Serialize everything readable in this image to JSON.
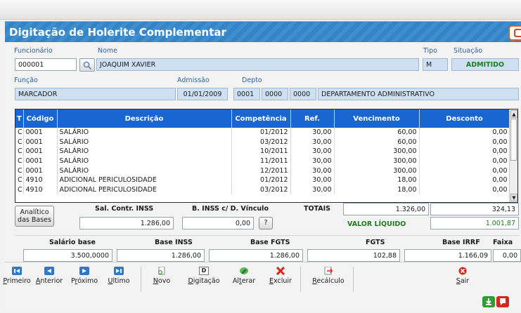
{
  "window": {
    "title": "Digitação de Holerite Complementar"
  },
  "employee": {
    "funcionario_label": "Funcionário",
    "funcionario": "000001",
    "nome_label": "Nome",
    "nome": "JOAQUIM XAVIER",
    "tipo_label": "Tipo",
    "tipo": "M",
    "situacao_label": "Situação",
    "situacao": "ADMITIDO",
    "funcao_label": "Função",
    "funcao": "MARCADOR",
    "admissao_label": "Admissão",
    "admissao": "01/01/2009",
    "depto_label": "Depto",
    "depto1": "0001",
    "depto2": "0000",
    "depto3": "0000",
    "depto_nome": "DEPARTAMENTO ADMINISTRATIVO"
  },
  "grid": {
    "headers": [
      "T",
      "Código",
      "Descrição",
      "Competência",
      "Ref.",
      "Vencimento",
      "Desconto"
    ],
    "rows": [
      [
        "C",
        "0001",
        "SALÁRIO",
        "01/2012",
        "30,00",
        "60,00",
        "0,00"
      ],
      [
        "C",
        "0001",
        "SALÁRIO",
        "03/2012",
        "30,00",
        "60,00",
        "0,00"
      ],
      [
        "C",
        "0001",
        "SALÁRIO",
        "10/2011",
        "30,00",
        "300,00",
        "0,00"
      ],
      [
        "C",
        "0001",
        "SALÁRIO",
        "11/2011",
        "30,00",
        "300,00",
        "0,00"
      ],
      [
        "C",
        "0001",
        "SALÁRIO",
        "12/2011",
        "30,00",
        "300,00",
        "0,00"
      ],
      [
        "C",
        "4910",
        "ADICIONAL PERICULOSIDADE",
        "01/2012",
        "30,00",
        "18,00",
        "0,00"
      ],
      [
        "C",
        "4910",
        "ADICIONAL PERICULOSIDADE",
        "03/2012",
        "30,00",
        "18,00",
        "0,00"
      ]
    ]
  },
  "summary": {
    "analitico_label": "Analítico das Bases",
    "sal_contr_inss_label": "Sal. Contr. INSS",
    "sal_contr_inss": "1.286,00",
    "b_inss_label": "B. INSS c/ D. Vínculo",
    "b_inss": "0,00",
    "help_label": "?",
    "totais_label": "TOTAIS",
    "total_venc": "1.326,00",
    "total_desc": "324,13",
    "liquido_label": "VALOR LÍQUIDO",
    "liquido": "1.001,87"
  },
  "bases": {
    "salario_base_label": "Salário base",
    "salario_base": "3.500,0000",
    "base_inss_label": "Base INSS",
    "base_inss": "1.286,00",
    "base_fgts_label": "Base FGTS",
    "base_fgts": "1.286,00",
    "fgts_label": "FGTS",
    "fgts": "102,88",
    "base_irrf_label": "Base IRRF",
    "base_irrf": "1.166,09",
    "faixa_label": "Faixa",
    "faixa": "0,00"
  },
  "toolbar": {
    "primeiro_u": "P",
    "primeiro_rest": "rimeiro",
    "anterior_u": "A",
    "anterior_rest": "nterior",
    "proximo_pre": "P",
    "proximo_u": "r",
    "proximo_rest": "óximo",
    "ultimo_u": "U",
    "ultimo_rest": "ltimo",
    "novo_u": "N",
    "novo_rest": "ovo",
    "digitacao_u": "D",
    "digitacao_rest": "igitação",
    "digitacao_icon_letter": "D",
    "alterar_pre": "Al",
    "alterar_u": "t",
    "alterar_rest": "erar",
    "excluir_u": "E",
    "excluir_rest": "xcluir",
    "recalculo_u": "R",
    "recalculo_rest": "ecálculo",
    "sair_u": "S",
    "sair_rest": "air"
  },
  "colors": {
    "title_bar": "#3584c6",
    "grid_header": "#1a66d0",
    "field_bg": "#cfe0f2",
    "accent_green": "#1d7d1d"
  }
}
